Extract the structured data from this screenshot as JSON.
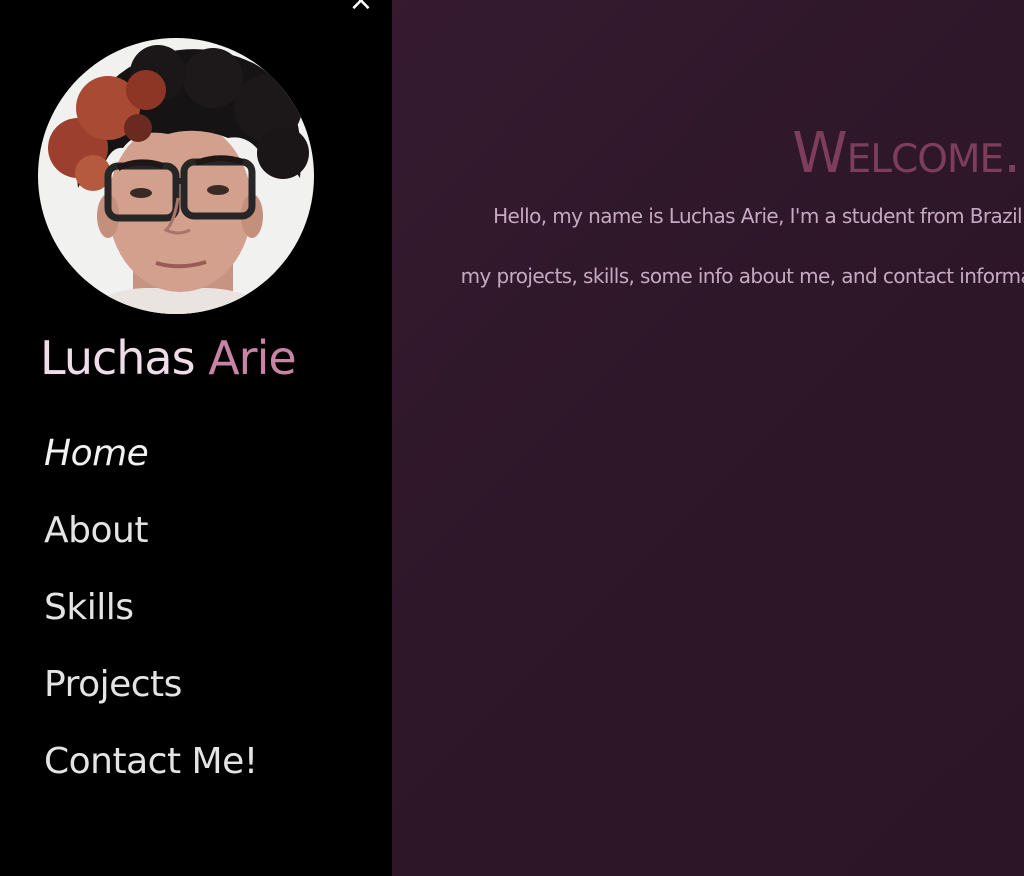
{
  "sidebar": {
    "close_label": "×",
    "name_first": "Luchas",
    "name_last": "Arie",
    "nav_items": [
      {
        "label": "Home",
        "active": true
      },
      {
        "label": "About",
        "active": false
      },
      {
        "label": "Skills",
        "active": false
      },
      {
        "label": "Projects",
        "active": false
      },
      {
        "label": "Contact Me!",
        "active": false
      }
    ]
  },
  "main": {
    "heading": "Welcome.",
    "intro_line_1": "Hello, my name is Luchas Arie, I'm a student from Brazil",
    "intro_line_2": "my projects, skills, some info about me, and contact informatio"
  },
  "colors": {
    "sidebar_bg": "#000000",
    "main_bg": "#2f1a2c",
    "heading": "#7d3e5c",
    "intro_text": "#c6a9c0",
    "name_accent": "#c983a6"
  }
}
